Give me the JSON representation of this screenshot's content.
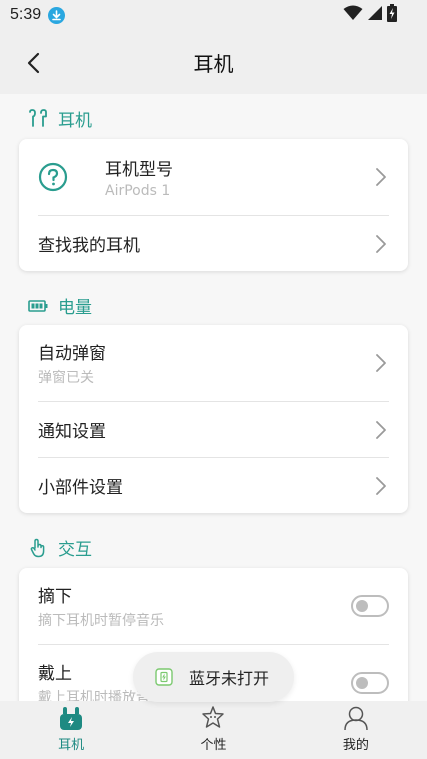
{
  "status_bar": {
    "time": "5:39"
  },
  "header": {
    "title": "耳机"
  },
  "sections": {
    "earbuds": {
      "title": "耳机",
      "model_title": "耳机型号",
      "model_value": "AirPods 1",
      "find_title": "查找我的耳机"
    },
    "battery": {
      "title": "电量",
      "popup_title": "自动弹窗",
      "popup_sub": "弹窗已关",
      "notify_title": "通知设置",
      "widget_title": "小部件设置"
    },
    "interaction": {
      "title": "交互",
      "remove_title": "摘下",
      "remove_sub": "摘下耳机时暂停音乐",
      "remove_enabled": false,
      "wear_title": "戴上",
      "wear_sub": "戴上耳机时播放音乐",
      "wear_enabled": false
    }
  },
  "toast": {
    "text": "蓝牙未打开"
  },
  "bottom_nav": [
    {
      "label": "耳机",
      "active": true
    },
    {
      "label": "个性",
      "active": false
    },
    {
      "label": "我的",
      "active": false
    }
  ],
  "colors": {
    "accent": "#2a9d8f",
    "nav_active": "#1e8a82",
    "toggle_off": "#bdbdbd"
  }
}
